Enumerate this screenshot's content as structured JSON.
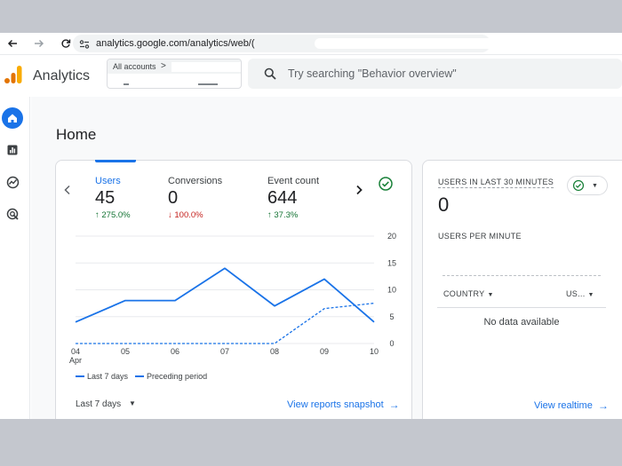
{
  "browser": {
    "back_icon": "back-arrow-icon",
    "forward_icon": "forward-arrow-icon",
    "reload_icon": "reload-icon",
    "url": "analytics.google.com/analytics/web/("
  },
  "header": {
    "app_title": "Analytics",
    "account_selector": {
      "label": "All accounts",
      "chevron": ">"
    },
    "search": {
      "placeholder": "Try searching \"Behavior overview\""
    }
  },
  "rail": {
    "items": [
      {
        "icon": "home-icon",
        "active": true
      },
      {
        "icon": "reports-icon",
        "active": false
      },
      {
        "icon": "explore-icon",
        "active": false
      },
      {
        "icon": "advertising-icon",
        "active": false
      }
    ]
  },
  "page": {
    "title": "Home"
  },
  "overview": {
    "metrics": [
      {
        "label": "Users",
        "value": "45",
        "change": "↑ 275.0%",
        "direction": "up"
      },
      {
        "label": "Conversions",
        "value": "0",
        "change": "↓ 100.0%",
        "direction": "down"
      },
      {
        "label": "Event count",
        "value": "644",
        "change": "↑ 37.3%",
        "direction": "up"
      }
    ],
    "legend": {
      "current": "Last 7 days",
      "previous": "Preceding period"
    },
    "date_range": "Last 7 days",
    "link": "View reports snapshot"
  },
  "chart_data": {
    "type": "line",
    "x": [
      "04",
      "05",
      "06",
      "07",
      "08",
      "09",
      "10"
    ],
    "x_sublabel": "Apr",
    "y_ticks": [
      "0",
      "5",
      "10",
      "15",
      "20"
    ],
    "ylim": [
      0,
      20
    ],
    "series": [
      {
        "name": "Last 7 days",
        "style": "solid",
        "values": [
          4,
          8,
          8,
          14,
          7,
          12,
          4
        ]
      },
      {
        "name": "Preceding period",
        "style": "dashed",
        "values": [
          0,
          0,
          0,
          0,
          0,
          6.5,
          7.5
        ]
      }
    ],
    "colors": {
      "line": "#1a73e8",
      "grid": "#e8eaed"
    }
  },
  "realtime": {
    "title": "USERS IN LAST 30 MINUTES",
    "value": "0",
    "subtitle": "USERS PER MINUTE",
    "col_country": "COUNTRY",
    "col_users": "US...",
    "empty": "No data available",
    "link": "View realtime"
  },
  "colors": {
    "accent": "#1a73e8",
    "up": "#137333",
    "down": "#c5221f",
    "ok": "#188038"
  }
}
